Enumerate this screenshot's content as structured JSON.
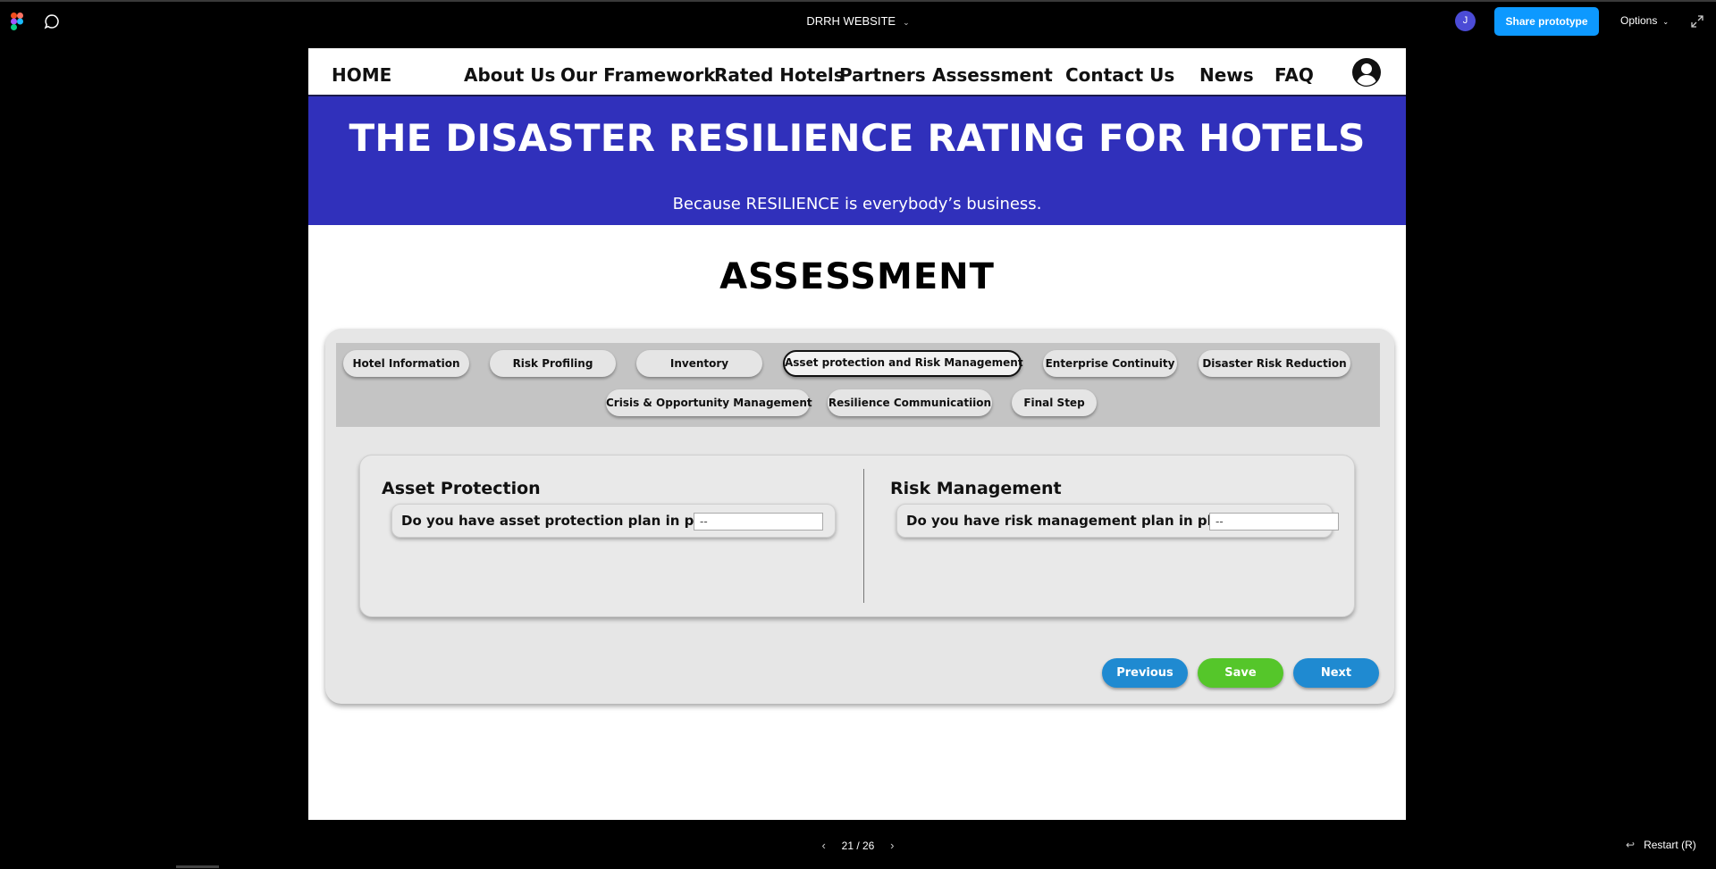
{
  "figma": {
    "file_title": "DRRH WEBSITE",
    "avatar_initial": "J",
    "share_label": "Share prototype",
    "options_label": "Options",
    "page_counter": "21 / 26",
    "restart_label": "Restart (R)",
    "colors": {
      "share": "#0d99ff",
      "avatar": "#4b4bd6"
    }
  },
  "nav": {
    "home": "HOME",
    "about": "About Us",
    "framework": "Our Framework",
    "rated": "Rated Hotels",
    "partners": "Partners",
    "assessment": "Assessment",
    "contact": "Contact Us",
    "news": "News",
    "faq": "FAQ"
  },
  "hero": {
    "title": "THE DISASTER RESILIENCE RATING FOR HOTELS",
    "tagline": "Because RESILIENCE is everybody’s business.",
    "color": "#3030bb"
  },
  "page": {
    "heading": "ASSESSMENT"
  },
  "tabs": {
    "t1": "Hotel Information",
    "t2": "Risk Profiling",
    "t3": "Inventory",
    "t4": "Asset protection and Risk Management",
    "t5": "Enterprise Continuity",
    "t6": "Disaster Risk Reduction",
    "t7": "Crisis & Opportunity Management",
    "t8": "Resilience Communicatiion",
    "t9": "Final Step",
    "active": "Asset protection and Risk Management"
  },
  "asset": {
    "title": "Asset Protection",
    "question": "Do you have asset protection plan in place?",
    "value": "--"
  },
  "risk": {
    "title": "Risk Management",
    "question": "Do you have risk management plan in place?",
    "value": "--"
  },
  "actions": {
    "previous": "Previous",
    "save": "Save",
    "next": "Next",
    "colors": {
      "previous": "#1f8ad1",
      "save": "#55c62a",
      "next": "#1f8ad1"
    }
  }
}
